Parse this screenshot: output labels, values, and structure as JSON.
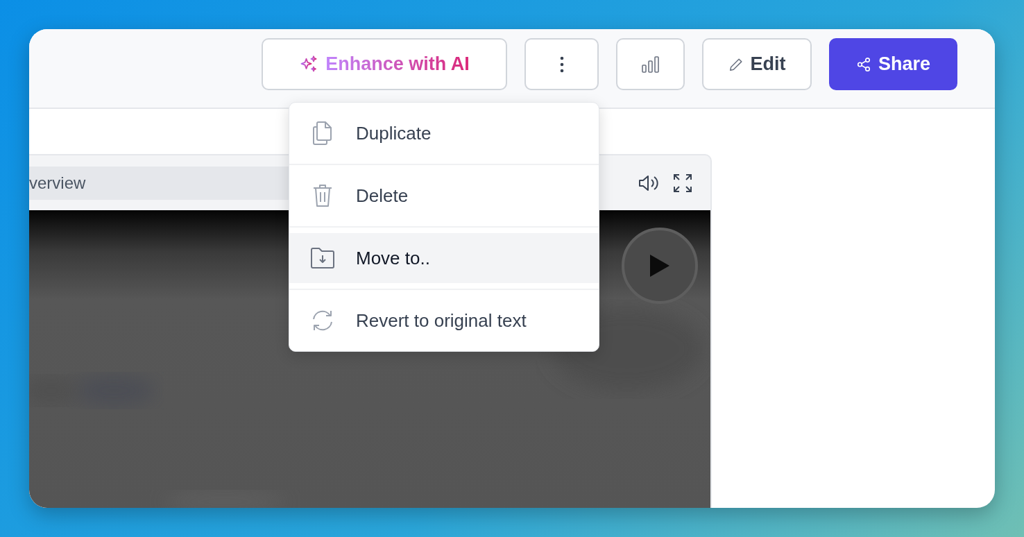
{
  "toolbar": {
    "buttons": [
      {
        "kind": "ai",
        "label": "Enhance with AI"
      },
      {
        "kind": "more"
      },
      {
        "kind": "stats"
      },
      {
        "kind": "edit",
        "label": "Edit"
      },
      {
        "kind": "share",
        "label": "Share"
      }
    ]
  },
  "video": {
    "title": "verview"
  },
  "menu": {
    "items": [
      {
        "kind": "duplicate",
        "label": "Duplicate",
        "selected": false
      },
      {
        "kind": "delete",
        "label": "Delete",
        "selected": false
      },
      {
        "kind": "move",
        "label": "Move to..",
        "selected": true
      },
      {
        "kind": "revert",
        "label": "Revert to original text",
        "selected": false
      }
    ]
  }
}
